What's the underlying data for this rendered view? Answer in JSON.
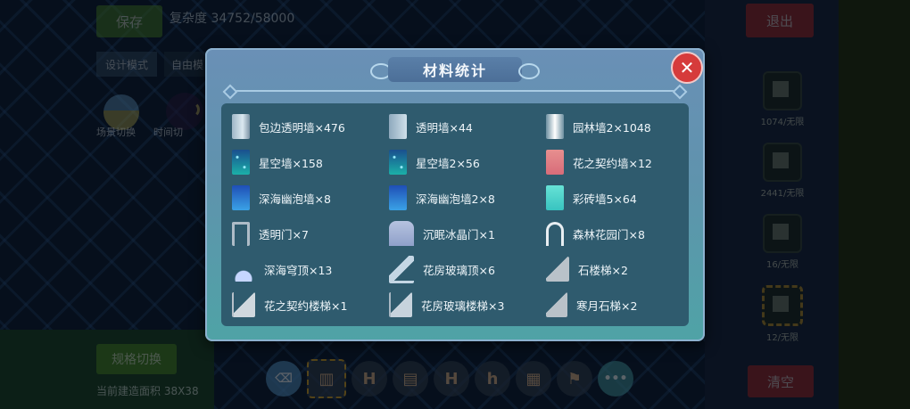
{
  "background": {
    "save_label": "保存",
    "complexity_label": "复杂度 34752/58000",
    "design_mode_label": "设计模式",
    "design_mode_value": "自由模",
    "scene_switch_label": "场景切换",
    "time_switch_label": "时间切",
    "exit_label": "退出",
    "spec_switch_label": "规格切换",
    "area_label": "当前建造面积 38X38",
    "clear_label": "清空",
    "palette": [
      {
        "count": "1074/无限"
      },
      {
        "count": "2441/无限"
      },
      {
        "count": "16/无限"
      },
      {
        "count": "12/无限"
      }
    ]
  },
  "toolbar": {
    "eraser_icon": "eraser-icon",
    "more_label": "•••",
    "tools": [
      "fence",
      "H",
      "wall",
      "frame",
      "chair",
      "window",
      "flag"
    ]
  },
  "modal": {
    "title": "材料统计",
    "close_symbol": "✕",
    "items": [
      {
        "label": "包边透明墙×476",
        "icon": "clear-wall"
      },
      {
        "label": "透明墙×44",
        "icon": "clear-wall-2"
      },
      {
        "label": "园林墙2×1048",
        "icon": "garden-wall"
      },
      {
        "label": "星空墙×158",
        "icon": "starry-wall"
      },
      {
        "label": "星空墙2×56",
        "icon": "starry-wall-2"
      },
      {
        "label": "花之契约墙×12",
        "icon": "flower-contract-wall"
      },
      {
        "label": "深海幽泡墙×8",
        "icon": "deep-sea-bubble-wall"
      },
      {
        "label": "深海幽泡墙2×8",
        "icon": "deep-sea-bubble-wall-2"
      },
      {
        "label": "彩砖墙5×64",
        "icon": "colored-brick-wall"
      },
      {
        "label": "透明门×7",
        "icon": "clear-door"
      },
      {
        "label": "沉眠冰晶门×1",
        "icon": "ice-crystal-door"
      },
      {
        "label": "森林花园门×8",
        "icon": "forest-garden-door"
      },
      {
        "label": "深海穹顶×13",
        "icon": "deep-sea-dome"
      },
      {
        "label": "花房玻璃顶×6",
        "icon": "greenhouse-glass-roof"
      },
      {
        "label": "石楼梯×2",
        "icon": "stone-stairs"
      },
      {
        "label": "花之契约楼梯×1",
        "icon": "flower-contract-stairs"
      },
      {
        "label": "花房玻璃楼梯×3",
        "icon": "greenhouse-glass-stairs"
      },
      {
        "label": "寒月石梯×2",
        "icon": "cold-moon-stone-stairs"
      }
    ]
  }
}
